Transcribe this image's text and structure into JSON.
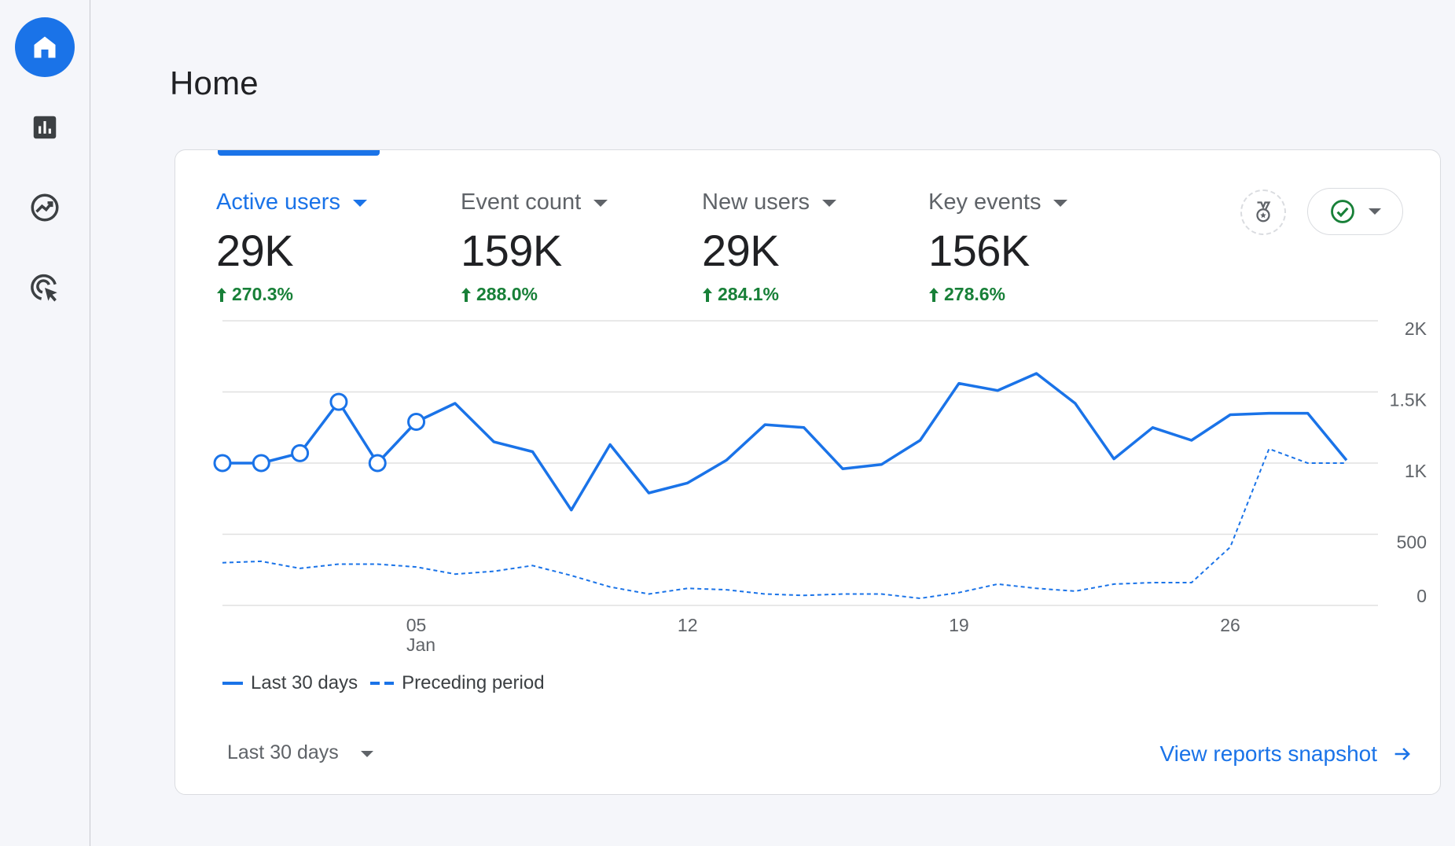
{
  "page": {
    "title": "Home"
  },
  "rail": {
    "items": [
      {
        "name": "home",
        "icon": "home-icon",
        "active": true
      },
      {
        "name": "reports",
        "icon": "bar-chart-icon",
        "active": false
      },
      {
        "name": "explore",
        "icon": "explore-trend-icon",
        "active": false
      },
      {
        "name": "advertising",
        "icon": "cursor-target-icon",
        "active": false
      }
    ]
  },
  "metrics": [
    {
      "label": "Active users",
      "value": "29K",
      "change": "270.3%",
      "selected": true
    },
    {
      "label": "Event count",
      "value": "159K",
      "change": "288.0%",
      "selected": false
    },
    {
      "label": "New users",
      "value": "29K",
      "change": "284.1%",
      "selected": false
    },
    {
      "label": "Key events",
      "value": "156K",
      "change": "278.6%",
      "selected": false
    }
  ],
  "legend": {
    "current": "Last 30 days",
    "previous": "Preceding period"
  },
  "range": {
    "label": "Last 30 days"
  },
  "snapshot_link": {
    "label": "View reports snapshot"
  },
  "colors": {
    "accent": "#1a73e8",
    "positive": "#188038",
    "grid": "#e0e0e0"
  },
  "chart_data": {
    "type": "line",
    "ylim": [
      0,
      2000
    ],
    "y_ticks": [
      {
        "label": "2K",
        "value": 2000
      },
      {
        "label": "1.5K",
        "value": 1500
      },
      {
        "label": "1K",
        "value": 1000
      },
      {
        "label": "500",
        "value": 500
      },
      {
        "label": "0",
        "value": 0
      }
    ],
    "x": [
      1,
      2,
      3,
      4,
      5,
      6,
      7,
      8,
      9,
      10,
      11,
      12,
      13,
      14,
      15,
      16,
      17,
      18,
      19,
      20,
      21,
      22,
      23,
      24,
      25,
      26,
      27,
      28,
      29,
      30
    ],
    "x_ticks": [
      {
        "day": 6,
        "label": "05",
        "sublabel": "Jan"
      },
      {
        "day": 13,
        "label": "12",
        "sublabel": ""
      },
      {
        "day": 20,
        "label": "19",
        "sublabel": ""
      },
      {
        "day": 27,
        "label": "26",
        "sublabel": ""
      }
    ],
    "series": [
      {
        "name": "Last 30 days",
        "style": "solid",
        "marker_count": 6,
        "values": [
          1000,
          1000,
          1070,
          1430,
          1000,
          1290,
          1420,
          1150,
          1080,
          670,
          1130,
          790,
          860,
          1020,
          1270,
          1250,
          960,
          990,
          1160,
          1560,
          1510,
          1630,
          1420,
          1030,
          1250,
          1160,
          1340,
          1350,
          1350,
          1020
        ]
      },
      {
        "name": "Preceding period",
        "style": "dashed",
        "values": [
          300,
          310,
          260,
          290,
          290,
          270,
          220,
          240,
          280,
          210,
          130,
          80,
          120,
          110,
          80,
          70,
          80,
          80,
          50,
          90,
          150,
          120,
          100,
          150,
          160,
          160,
          410,
          1100,
          1000,
          1000
        ]
      }
    ]
  }
}
